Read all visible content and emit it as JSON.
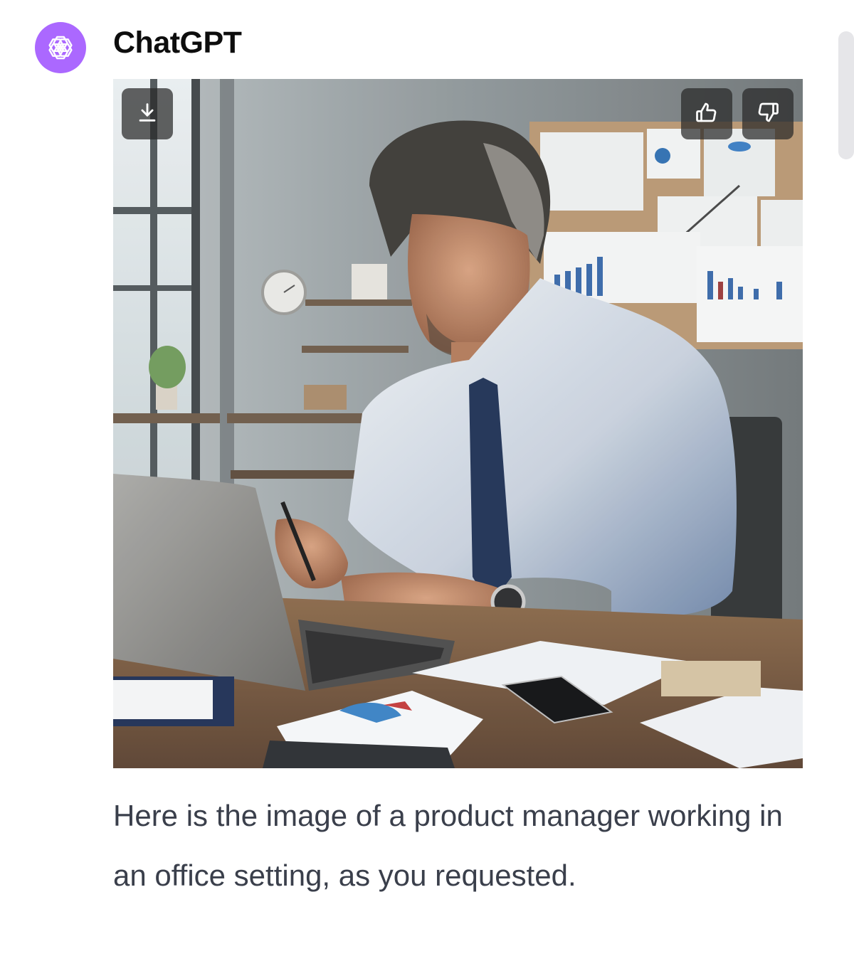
{
  "message": {
    "sender": "ChatGPT",
    "avatar_icon": "openai-logo-icon",
    "avatar_color": "#ab68ff",
    "image": {
      "description_icon": "generated-image",
      "actions": {
        "download_icon": "download-icon",
        "thumbs_up_icon": "thumbs-up-icon",
        "thumbs_down_icon": "thumbs-down-icon"
      }
    },
    "text": "Here is the image of a product manager working in an office setting, as you requested."
  }
}
